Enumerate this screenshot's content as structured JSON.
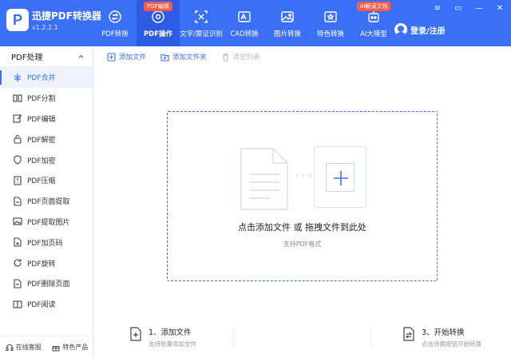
{
  "app": {
    "name": "迅捷PDF转换器",
    "version": "v1.2.2.1",
    "logo_letter": "P"
  },
  "nav": [
    {
      "label": "PDF转换",
      "icon": "convert-icon",
      "active": false,
      "badge": ""
    },
    {
      "label": "PDF操作",
      "icon": "target-icon",
      "active": true,
      "badge": "PDF编辑"
    },
    {
      "label": "文字/票证识别",
      "icon": "scan-frame-icon",
      "active": false,
      "badge": ""
    },
    {
      "label": "CAD转换",
      "icon": "cad-icon",
      "active": false,
      "badge": ""
    },
    {
      "label": "图片转换",
      "icon": "image-icon",
      "active": false,
      "badge": ""
    },
    {
      "label": "特色转换",
      "icon": "star-box-icon",
      "active": false,
      "badge": ""
    },
    {
      "label": "AI大模型",
      "icon": "ai-robot-icon",
      "active": false,
      "badge": "AI解读文档"
    }
  ],
  "user": {
    "label": "登录/注册"
  },
  "window": {
    "controls": [
      "≡",
      "▭",
      "—",
      "✕"
    ]
  },
  "sidebar": {
    "header": "PDF处理",
    "items": [
      {
        "label": "PDF合并",
        "icon": "merge-icon",
        "active": true
      },
      {
        "label": "PDF分割",
        "icon": "split-icon",
        "active": false
      },
      {
        "label": "PDF编辑",
        "icon": "edit-icon",
        "active": false
      },
      {
        "label": "PDF解密",
        "icon": "unlock-icon",
        "active": false
      },
      {
        "label": "PDF加密",
        "icon": "shield-icon",
        "active": false
      },
      {
        "label": "PDF压缩",
        "icon": "compress-icon",
        "active": false
      },
      {
        "label": "PDF页面提取",
        "icon": "page-extract-icon",
        "active": false
      },
      {
        "label": "PDF提取图片",
        "icon": "image-extract-icon",
        "active": false
      },
      {
        "label": "PDF加页码",
        "icon": "page-number-icon",
        "active": false
      },
      {
        "label": "PDF旋转",
        "icon": "rotate-icon",
        "active": false
      },
      {
        "label": "PDF删除页面",
        "icon": "page-delete-icon",
        "active": false
      },
      {
        "label": "PDF阅读",
        "icon": "read-icon",
        "active": false
      }
    ],
    "footer": {
      "service": "在线客服",
      "products": "特色产品"
    }
  },
  "toolbar": {
    "add_file": "添加文件",
    "add_folder": "添加文件夹",
    "clear_list": "清空列表"
  },
  "dropzone": {
    "arrows": "› › ›",
    "main": "点击添加文件 或 拖拽文件到此处",
    "sub": "支持PDF格式"
  },
  "steps": [
    {
      "title": "1、添加文件",
      "sub": "支持批量添加文件"
    },
    {
      "title": "3、开始转换",
      "sub": "点击转换按钮开始转换"
    }
  ],
  "colors": {
    "primary": "#3a6ff7",
    "badge": "#ff5b4a"
  }
}
